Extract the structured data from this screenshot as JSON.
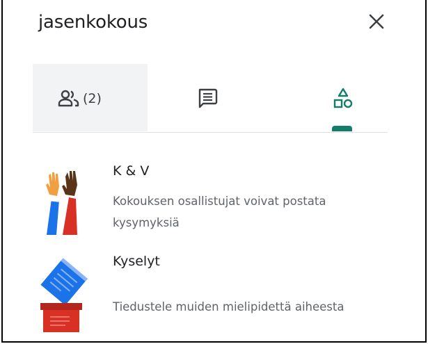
{
  "header": {
    "title": "jasenkokous",
    "close_icon": "close-icon"
  },
  "tabs": {
    "people": {
      "icon": "people-icon",
      "count_label": "(2)"
    },
    "chat": {
      "icon": "chat-icon"
    },
    "activities": {
      "icon": "shapes-icon",
      "selected": true
    }
  },
  "activities": [
    {
      "title": "K & V",
      "description": "Kokouksen osallistujat voivat postata kysymyksiä",
      "illustration": "raised-hands-illustration"
    },
    {
      "title": "Kyselyt",
      "description": "Tiedustele muiden mielipidettä aiheesta",
      "illustration": "ballot-box-illustration"
    }
  ],
  "colors": {
    "accent": "#137c6b",
    "text_primary": "#202124",
    "text_secondary": "#5f6368",
    "tab_selected_bg": "#f1f3f4"
  }
}
